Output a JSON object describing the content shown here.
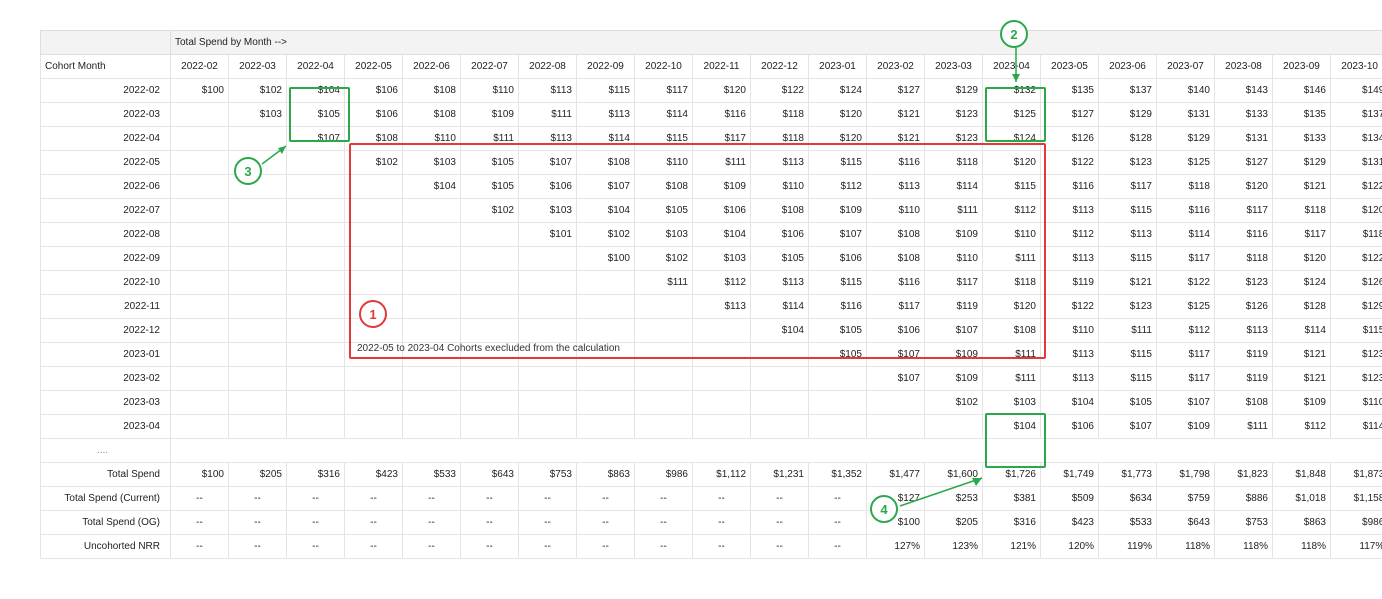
{
  "title": "Total Spend by Month -->",
  "row_label_header": "Cohort Month",
  "months": [
    "2022-02",
    "2022-03",
    "2022-04",
    "2022-05",
    "2022-06",
    "2022-07",
    "2022-08",
    "2022-09",
    "2022-10",
    "2022-11",
    "2022-12",
    "2023-01",
    "2023-02",
    "2023-03",
    "2023-04",
    "2023-05",
    "2023-06",
    "2023-07",
    "2023-08",
    "2023-09",
    "2023-10"
  ],
  "cohorts": [
    {
      "label": "2022-02",
      "start": 0,
      "values": [
        "$100",
        "$102",
        "$104",
        "$106",
        "$108",
        "$110",
        "$113",
        "$115",
        "$117",
        "$120",
        "$122",
        "$124",
        "$127",
        "$129",
        "$132",
        "$135",
        "$137",
        "$140",
        "$143",
        "$146",
        "$149"
      ]
    },
    {
      "label": "2022-03",
      "start": 1,
      "values": [
        "$103",
        "$105",
        "$106",
        "$108",
        "$109",
        "$111",
        "$113",
        "$114",
        "$116",
        "$118",
        "$120",
        "$121",
        "$123",
        "$125",
        "$127",
        "$129",
        "$131",
        "$133",
        "$135",
        "$137"
      ]
    },
    {
      "label": "2022-04",
      "start": 2,
      "values": [
        "$107",
        "$108",
        "$110",
        "$111",
        "$113",
        "$114",
        "$115",
        "$117",
        "$118",
        "$120",
        "$121",
        "$123",
        "$124",
        "$126",
        "$128",
        "$129",
        "$131",
        "$133",
        "$134"
      ]
    },
    {
      "label": "2022-05",
      "start": 3,
      "values": [
        "$102",
        "$103",
        "$105",
        "$107",
        "$108",
        "$110",
        "$111",
        "$113",
        "$115",
        "$116",
        "$118",
        "$120",
        "$122",
        "$123",
        "$125",
        "$127",
        "$129",
        "$131"
      ]
    },
    {
      "label": "2022-06",
      "start": 4,
      "values": [
        "$104",
        "$105",
        "$106",
        "$107",
        "$108",
        "$109",
        "$110",
        "$112",
        "$113",
        "$114",
        "$115",
        "$116",
        "$117",
        "$118",
        "$120",
        "$121",
        "$122"
      ]
    },
    {
      "label": "2022-07",
      "start": 5,
      "values": [
        "$102",
        "$103",
        "$104",
        "$105",
        "$106",
        "$108",
        "$109",
        "$110",
        "$111",
        "$112",
        "$113",
        "$115",
        "$116",
        "$117",
        "$118",
        "$120"
      ]
    },
    {
      "label": "2022-08",
      "start": 6,
      "values": [
        "$101",
        "$102",
        "$103",
        "$104",
        "$106",
        "$107",
        "$108",
        "$109",
        "$110",
        "$112",
        "$113",
        "$114",
        "$116",
        "$117",
        "$118"
      ]
    },
    {
      "label": "2022-09",
      "start": 7,
      "values": [
        "$100",
        "$102",
        "$103",
        "$105",
        "$106",
        "$108",
        "$110",
        "$111",
        "$113",
        "$115",
        "$117",
        "$118",
        "$120",
        "$122"
      ]
    },
    {
      "label": "2022-10",
      "start": 8,
      "values": [
        "$111",
        "$112",
        "$113",
        "$115",
        "$116",
        "$117",
        "$118",
        "$119",
        "$121",
        "$122",
        "$123",
        "$124",
        "$126"
      ]
    },
    {
      "label": "2022-11",
      "start": 9,
      "values": [
        "$113",
        "$114",
        "$116",
        "$117",
        "$119",
        "$120",
        "$122",
        "$123",
        "$125",
        "$126",
        "$128",
        "$129"
      ]
    },
    {
      "label": "2022-12",
      "start": 10,
      "values": [
        "$104",
        "$105",
        "$106",
        "$107",
        "$108",
        "$110",
        "$111",
        "$112",
        "$113",
        "$114",
        "$115"
      ]
    },
    {
      "label": "2023-01",
      "start": 11,
      "values": [
        "$105",
        "$107",
        "$109",
        "$111",
        "$113",
        "$115",
        "$117",
        "$119",
        "$121",
        "$123"
      ]
    },
    {
      "label": "2023-02",
      "start": 12,
      "values": [
        "$107",
        "$109",
        "$111",
        "$113",
        "$115",
        "$117",
        "$119",
        "$121",
        "$123"
      ]
    },
    {
      "label": "2023-03",
      "start": 13,
      "values": [
        "$102",
        "$103",
        "$104",
        "$105",
        "$107",
        "$108",
        "$109",
        "$110"
      ]
    },
    {
      "label": "2023-04",
      "start": 14,
      "values": [
        "$104",
        "$106",
        "$107",
        "$109",
        "$111",
        "$112",
        "$114"
      ]
    }
  ],
  "note": "2022-05 to 2023-04 Cohorts execluded from the calculation",
  "dots": "....",
  "summary": [
    {
      "label": "Total Spend",
      "cells": [
        "$100",
        "$205",
        "$316",
        "$423",
        "$533",
        "$643",
        "$753",
        "$863",
        "$986",
        "$1,112",
        "$1,231",
        "$1,352",
        "$1,477",
        "$1,600",
        "$1,726",
        "$1,749",
        "$1,773",
        "$1,798",
        "$1,823",
        "$1,848",
        "$1,873"
      ]
    },
    {
      "label": "Total Spend (Current)",
      "cells": [
        "--",
        "--",
        "--",
        "--",
        "--",
        "--",
        "--",
        "--",
        "--",
        "--",
        "--",
        "--",
        "$127",
        "$253",
        "$381",
        "$509",
        "$634",
        "$759",
        "$886",
        "$1,018",
        "$1,158"
      ]
    },
    {
      "label": "Total Spend (OG)",
      "cells": [
        "--",
        "--",
        "--",
        "--",
        "--",
        "--",
        "--",
        "--",
        "--",
        "--",
        "--",
        "--",
        "$100",
        "$205",
        "$316",
        "$423",
        "$533",
        "$643",
        "$753",
        "$863",
        "$986"
      ]
    },
    {
      "label": "Uncohorted NRR",
      "cells": [
        "--",
        "--",
        "--",
        "--",
        "--",
        "--",
        "--",
        "--",
        "--",
        "--",
        "--",
        "--",
        "127%",
        "123%",
        "121%",
        "120%",
        "119%",
        "118%",
        "118%",
        "118%",
        "117%"
      ]
    }
  ],
  "callouts": {
    "1": "1",
    "2": "2",
    "3": "3",
    "4": "4"
  }
}
